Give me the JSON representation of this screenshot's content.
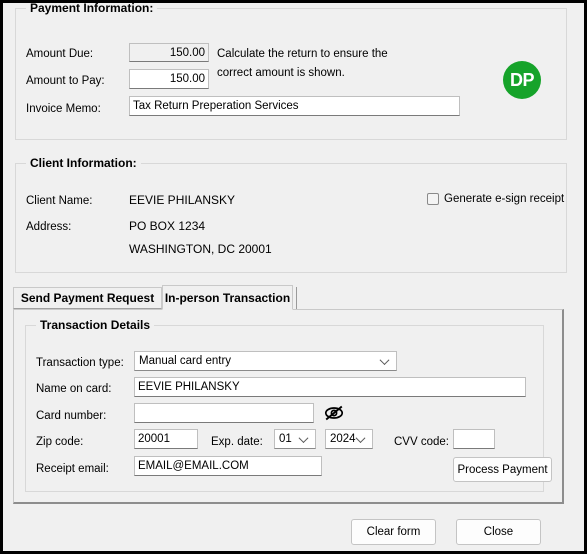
{
  "window": {
    "background": "#f0f0f0",
    "brand_color": "#16a32a"
  },
  "payment_information": {
    "legend": "Payment Information:",
    "amount_due_label": "Amount Due:",
    "amount_due_value": "150.00",
    "amount_to_pay_label": "Amount to Pay:",
    "amount_to_pay_value": "150.00",
    "helper_line1": "Calculate the return to ensure the",
    "helper_line2": "correct amount is shown.",
    "invoice_memo_label": "Invoice Memo:",
    "invoice_memo_value": "Tax Return Preperation Services",
    "logo_text": "DP"
  },
  "client_information": {
    "legend": "Client Information:",
    "client_name_label": "Client Name:",
    "client_name_value": "EEVIE PHILANSKY",
    "address_label": "Address:",
    "address_line1": "PO BOX 1234",
    "address_line2": "WASHINGTON, DC 20001",
    "esign_checkbox_label": "Generate e-sign receipt",
    "esign_checked": false
  },
  "tabs": [
    {
      "label": "Send Payment Request",
      "active": false
    },
    {
      "label": "In-person Transaction",
      "active": true
    }
  ],
  "transaction_details": {
    "legend": "Transaction Details",
    "transaction_type_label": "Transaction type:",
    "transaction_type_value": "Manual card entry",
    "name_on_card_label": "Name on card:",
    "name_on_card_value": "EEVIE PHILANSKY",
    "card_number_label": "Card number:",
    "card_number_value": "",
    "card_number_placeholder": "",
    "reveal_icon": "eye-slash-icon",
    "zip_code_label": "Zip code:",
    "zip_code_value": "20001",
    "exp_date_label": "Exp. date:",
    "exp_month_value": "01",
    "exp_year_value": "2024",
    "cvv_label": "CVV code:",
    "cvv_value": "",
    "receipt_email_label": "Receipt email:",
    "receipt_email_value": "EMAIL@EMAIL.COM",
    "process_payment_label": "Process Payment"
  },
  "footer": {
    "clear_form_label": "Clear form",
    "close_label": "Close"
  }
}
